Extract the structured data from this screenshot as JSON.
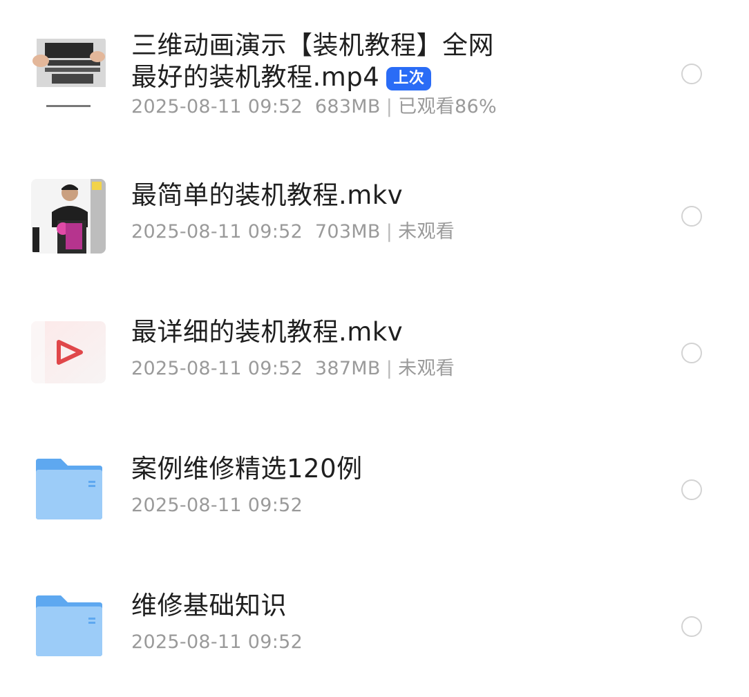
{
  "items": [
    {
      "name": "三维动画演示【装机教程】全网最好的装机教程.mp4",
      "name_line1": "三维动画演示【装机教程】全网",
      "name_line2": "最好的装机教程.mp4",
      "badge": "上次",
      "date": "2025-08-11 09:52",
      "size": "683MB",
      "status": "已观看86%",
      "icon": "video-thumbnail-motherboard"
    },
    {
      "name": "最简单的装机教程.mkv",
      "date": "2025-08-11 09:52",
      "size": "703MB",
      "status": "未观看",
      "icon": "video-thumbnail-person"
    },
    {
      "name": "最详细的装机教程.mkv",
      "date": "2025-08-11 09:52",
      "size": "387MB",
      "status": "未观看",
      "icon": "video-file-icon"
    },
    {
      "name": "案例维修精选120例",
      "date": "2025-08-11 09:52",
      "icon": "folder-icon"
    },
    {
      "name": "维修基础知识",
      "date": "2025-08-11 09:52",
      "icon": "folder-icon"
    }
  ],
  "separator": "|",
  "colors": {
    "badge": "#2a6cf6",
    "folder": "#7fbcf5",
    "play": "#e0474a"
  }
}
